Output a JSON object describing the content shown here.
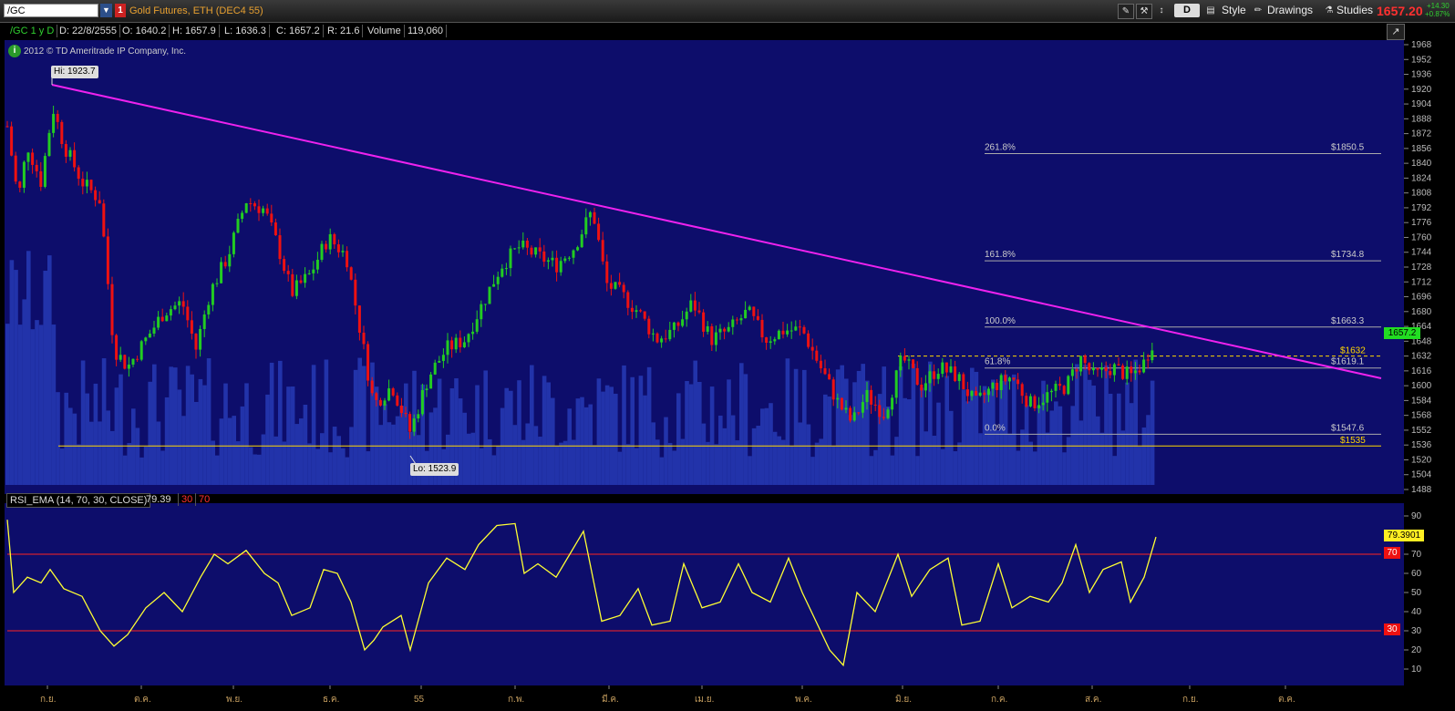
{
  "toolbar": {
    "symbol": "/GC",
    "link_badge": "1",
    "description": "Gold Futures, ETH (DEC4 55)",
    "d_button": "D",
    "style_label": "Style",
    "drawings_label": "Drawings",
    "studies_label": "Studies",
    "last_price": "1657.20",
    "change_abs": "+14.30",
    "change_pct": "+0.87%"
  },
  "infobar": {
    "timeframe": "/GC 1 y D",
    "date": "D: 22/8/2555",
    "open": "O: 1640.2",
    "high": "H: 1657.9",
    "low": "L: 1636.3",
    "close": "C: 1657.2",
    "range": "R: 21.6",
    "volume_label": "Volume",
    "volume_value": "119,060"
  },
  "copyright": "2012 © TD Ameritrade IP Company, Inc.",
  "annotations": {
    "hi_label": "Hi: 1923.7",
    "lo_label": "Lo: 1523.9",
    "current_price_tag": "1657.2"
  },
  "fibonacci": [
    {
      "pct": "261.8%",
      "price": "$1850.5",
      "value": 1850.5
    },
    {
      "pct": "161.8%",
      "price": "$1734.8",
      "value": 1734.8
    },
    {
      "pct": "100.0%",
      "price": "$1663.3",
      "value": 1663.3
    },
    {
      "pct": "61.8%",
      "price": "$1619.1",
      "value": 1619.1
    },
    {
      "pct": "0.0%",
      "price": "$1547.6",
      "value": 1547.6
    }
  ],
  "horizontal_lines": [
    {
      "label": "$1632",
      "value": 1632,
      "color": "#ffd700",
      "style": "dashed"
    },
    {
      "label": "$1535",
      "value": 1535,
      "color": "#ffd700",
      "style": "solid"
    }
  ],
  "price_axis": {
    "ticks": [
      "1968",
      "1952",
      "1936",
      "1920",
      "1904",
      "1888",
      "1872",
      "1856",
      "1840",
      "1824",
      "1808",
      "1792",
      "1776",
      "1760",
      "1744",
      "1728",
      "1712",
      "1696",
      "1680",
      "1664",
      "1648",
      "1632",
      "1616",
      "1600",
      "1584",
      "1568",
      "1552",
      "1536",
      "1520",
      "1504",
      "1488"
    ]
  },
  "rsi": {
    "title": "RSI_EMA (14, 70, 30, CLOSE)",
    "value": "79.39",
    "over_sold_label": "30",
    "over_bought_label": "70",
    "current_tag": "79.3901",
    "ob_tag": "70",
    "os_tag": "30",
    "axis_ticks": [
      "90",
      "80",
      "70",
      "60",
      "50",
      "40",
      "30",
      "20",
      "10"
    ]
  },
  "time_axis": {
    "labels": [
      "ก.ย.",
      "ต.ค.",
      "พ.ย.",
      "ธ.ค.",
      "55",
      "ก.พ.",
      "มี.ค.",
      "เม.ย.",
      "พ.ค.",
      "มิ.ย.",
      "ก.ค.",
      "ส.ค.",
      "ก.ย.",
      "ต.ค."
    ]
  },
  "colors": {
    "background": "#0d0d6b",
    "volume": "#2233aa",
    "up_candle": "#22cc22",
    "down_candle": "#ee1111",
    "trendline": "#ee22ee",
    "rsi_line": "#ffff33",
    "rsi_levels": "#ff2222",
    "fib_lines": "#aaaaaa"
  }
}
